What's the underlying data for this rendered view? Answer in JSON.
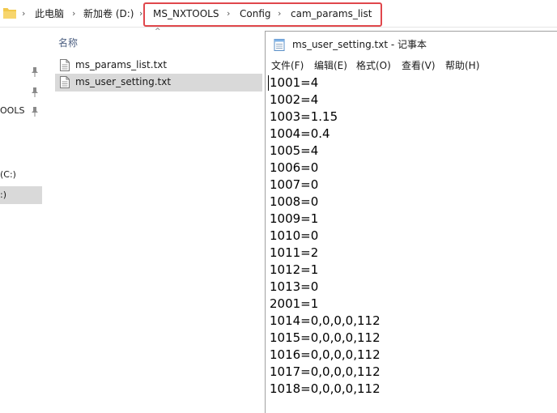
{
  "address_bar": {
    "crumbs": [
      "此电脑",
      "新加卷 (D:)",
      "MS_NXTOOLS",
      "Config",
      "cam_params_list"
    ],
    "separator": "›"
  },
  "nav_pane": {
    "items": [
      "OOLS",
      "(C:)",
      ":)"
    ]
  },
  "file_list": {
    "column_name": "名称",
    "files": [
      "ms_params_list.txt",
      "ms_user_setting.txt"
    ],
    "selected_index": 1
  },
  "notepad": {
    "title": "ms_user_setting.txt - 记事本",
    "menu": [
      "文件(F)",
      "编辑(E)",
      "格式(O)",
      "查看(V)",
      "帮助(H)"
    ],
    "lines": [
      "1001=4",
      "1002=4",
      "1003=1.15",
      "1004=0.4",
      "1005=4",
      "1006=0",
      "1007=0",
      "1008=0",
      "1009=1",
      "1010=0",
      "1011=2",
      "1012=1",
      "1013=0",
      "2001=1",
      "1014=0,0,0,0,112",
      "1015=0,0,0,0,112",
      "1016=0,0,0,0,112",
      "1017=0,0,0,0,112",
      "1018=0,0,0,0,112"
    ]
  },
  "colors": {
    "highlight_border": "#e0474c",
    "selection": "#d9d9d9",
    "column_header": "#4d6082"
  }
}
